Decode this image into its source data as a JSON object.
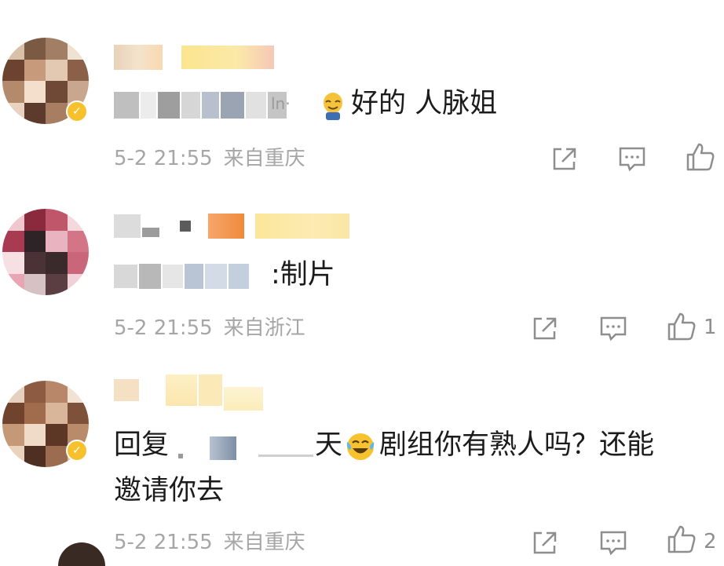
{
  "comments": [
    {
      "text_visible": "好的 人脉姐",
      "partial_prefix": "ln·",
      "time": "5-2 21:55",
      "location": "来自重庆",
      "like_count": "",
      "verified": true
    },
    {
      "text_visible": ":制片",
      "time": "5-2 21:55",
      "location": "来自浙江",
      "like_count": "1",
      "verified": false
    },
    {
      "reply_prefix": "回复",
      "text_before_emoji": "天",
      "text_after_emoji": "剧组你有熟人吗？还能",
      "text_line2": "邀请你去",
      "time": "5-2 21:55",
      "location": "来自重庆",
      "like_count": "2",
      "verified": true
    }
  ],
  "icons": {
    "share": "share-icon",
    "comment": "comment-icon",
    "like": "thumbs-up-icon",
    "verified": "verified-badge-icon"
  },
  "colors": {
    "text": "#1c1c1c",
    "meta": "#a6a6a6",
    "icon": "#8e8e8e",
    "badge": "#f7c12e"
  }
}
